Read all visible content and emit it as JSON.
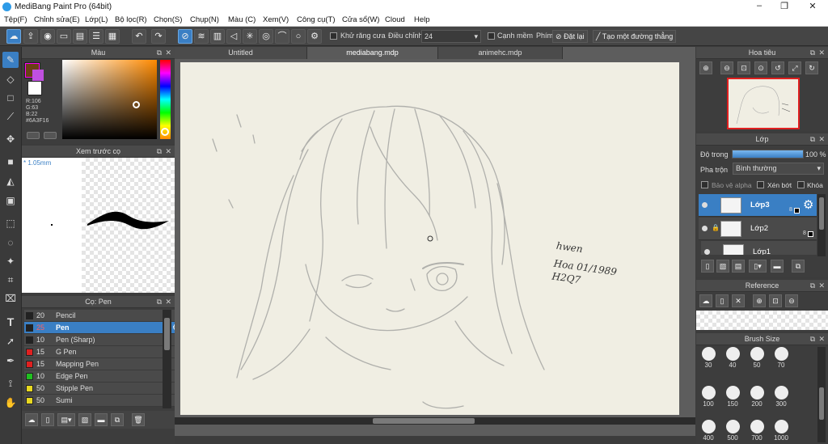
{
  "app": {
    "title": "MediBang Paint Pro (64bit)"
  },
  "window_controls": {
    "minimize": "–",
    "restore": "❐",
    "close": "✕"
  },
  "menu": [
    "Tệp(F)",
    "Chỉnh sửa(E)",
    "Lớp(L)",
    "Bộ lọc(R)",
    "Chọn(S)",
    "Chụp(N)",
    "Màu (C)",
    "Xem(V)",
    "Công cụ(T)",
    "Cửa sổ(W)",
    "Cloud",
    "Help"
  ],
  "toolbar": {
    "antialias_label": "Khử răng cưa",
    "correction_label": "Điều chỉnh",
    "correction_value": "24",
    "edge_label": "Cạnh mềm",
    "key_label": "Phím",
    "reset_label": "Đặt lại",
    "new_ruler_label": "Tạo một đường thẳng"
  },
  "color_panel": {
    "title": "Màu",
    "readout": [
      "R:106",
      "G:63",
      "B:22",
      "#6A3F16"
    ],
    "fg_color": "#6a3f16",
    "bg_color": "#ffffff"
  },
  "preview_panel": {
    "title": "Xem trước cọ",
    "size": "* 1.05mm"
  },
  "brush_panel": {
    "title": "Cọ: Pen",
    "brushes": [
      {
        "size": "20",
        "name": "Pencil",
        "color": "#222222",
        "selected": false
      },
      {
        "size": "25",
        "name": "Pen",
        "color": "#222222",
        "selected": true
      },
      {
        "size": "10",
        "name": "Pen (Sharp)",
        "color": "#222222",
        "selected": false
      },
      {
        "size": "15",
        "name": "G Pen",
        "color": "#e02020",
        "selected": false
      },
      {
        "size": "15",
        "name": "Mapping Pen",
        "color": "#e02020",
        "selected": false
      },
      {
        "size": "10",
        "name": "Edge Pen",
        "color": "#20c020",
        "selected": false
      },
      {
        "size": "50",
        "name": "Stipple Pen",
        "color": "#e8d820",
        "selected": false
      },
      {
        "size": "50",
        "name": "Sumi",
        "color": "#e8d820",
        "selected": false
      }
    ]
  },
  "tabs": [
    {
      "label": "Untitled",
      "active": false
    },
    {
      "label": "mediabang.mdp",
      "active": true
    },
    {
      "label": "animehc.mdp",
      "active": false
    }
  ],
  "canvas": {
    "signature_lines": [
      "hwen",
      "Hoa 01/1989",
      "H2Q7"
    ]
  },
  "navigator_panel": {
    "title": "Hoa tiêu"
  },
  "layer_panel": {
    "title": "Lớp",
    "opacity_label": "Độ trong",
    "opacity_value": "100 %",
    "opacity_fraction": 1.0,
    "blend_label": "Pha trộn",
    "blend_value": "Bình thường",
    "protect_alpha_label": "Bảo vệ alpha",
    "clip_label": "Xén bớt",
    "lock_label": "Khóa",
    "layers": [
      {
        "name": "Lớp3",
        "bits": "8",
        "selected": true
      },
      {
        "name": "Lớp2",
        "bits": "8",
        "selected": false
      },
      {
        "name": "Lớp1",
        "bits": "",
        "selected": false
      }
    ]
  },
  "reference_panel": {
    "title": "Reference"
  },
  "brush_size_panel": {
    "title": "Brush Size",
    "sizes": [
      "30",
      "40",
      "50",
      "70",
      "100",
      "150",
      "200",
      "300",
      "400",
      "500",
      "700",
      "1000"
    ]
  },
  "colors": {
    "accent": "#3a7fc4",
    "panel": "#3d3d3d",
    "paper": "#f0eee3"
  }
}
